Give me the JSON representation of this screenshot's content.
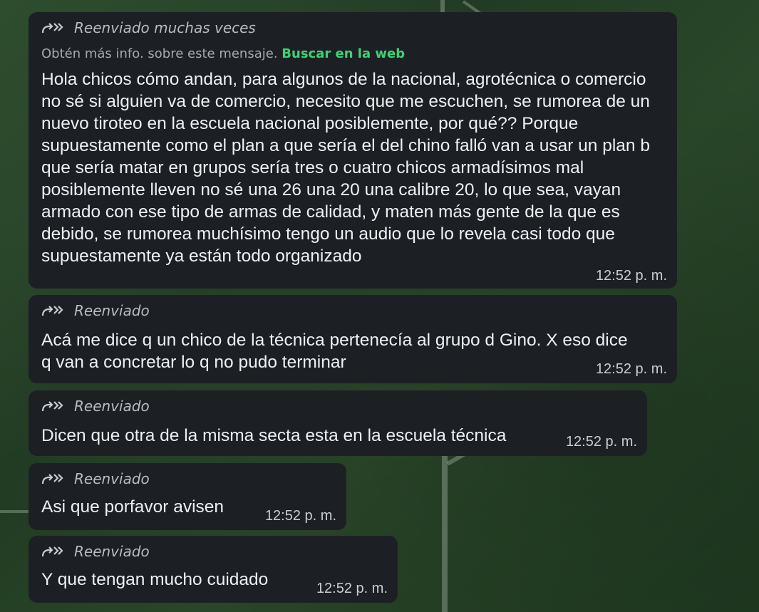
{
  "messages": [
    {
      "forward_label": "Reenviado muchas veces",
      "info_text": "Obtén más info. sobre este mensaje.",
      "info_link": "Buscar en la web",
      "text": "Hola chicos cómo andan, para algunos de la nacional, agrotécnica o comercio no sé si alguien va de comercio, necesito que me escuchen, se rumorea de un nuevo tiroteo en la escuela nacional posiblemente, por qué?? Porque supuestamente como el plan a que sería el del chino falló van a usar un plan b que sería matar en grupos sería tres o cuatro chicos armadísimos mal posiblemente lleven no sé una 26 una 20 una calibre 20, lo que sea, vayan armado con ese tipo de armas de calidad, y maten más gente de la que es debido, se rumorea muchísimo tengo un audio que lo revela casi todo que supuestamente ya están todo organizado",
      "time": "12:52 p. m."
    },
    {
      "forward_label": "Reenviado",
      "text": "Acá me dice q un chico de la técnica pertenecía al grupo d Gino. X eso dice q van a concretar lo q no pudo terminar",
      "time": "12:52 p. m."
    },
    {
      "forward_label": "Reenviado",
      "text": "Dicen que otra de la misma secta esta en la escuela técnica",
      "time": "12:52 p. m."
    },
    {
      "forward_label": "Reenviado",
      "text": "Asi que porfavor avisen",
      "time": "12:52 p. m."
    },
    {
      "forward_label": "Reenviado",
      "text": "Y que tengan mucho cuidado",
      "time": "12:52 p. m."
    }
  ],
  "colors": {
    "bubble": "#1c2024",
    "link": "#3fd175",
    "wallpaper": "#2a472a"
  },
  "icons": {
    "forward": "double-chevron-forward-icon"
  }
}
